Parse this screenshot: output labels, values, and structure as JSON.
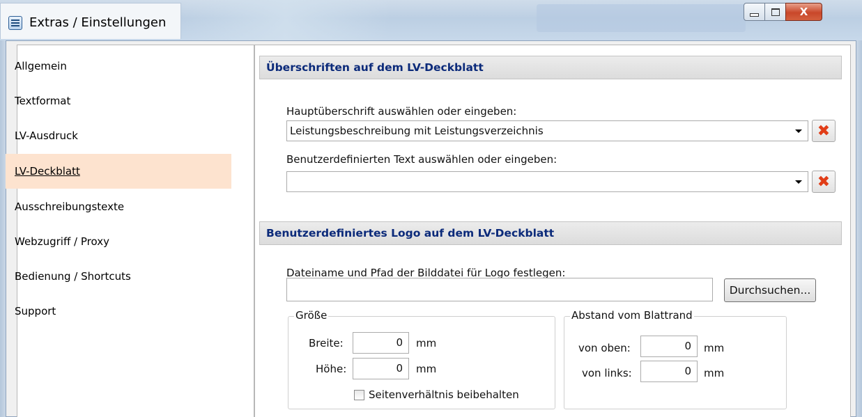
{
  "window": {
    "title": "Extras / Einstellungen",
    "close_glyph": "X"
  },
  "sidebar": {
    "items": [
      {
        "label": "Allgemein"
      },
      {
        "label": "Textformat"
      },
      {
        "label": "LV-Ausdruck"
      },
      {
        "label": "LV-Deckblatt",
        "active": true
      },
      {
        "label": "Ausschreibungstexte"
      },
      {
        "label": "Webzugriff / Proxy"
      },
      {
        "label": "Bedienung / Shortcuts"
      },
      {
        "label": "Support"
      }
    ]
  },
  "headings": {
    "section": "Überschriften auf dem LV-Deckblatt",
    "main_label": "Hauptüberschrift auswählen oder eingeben:",
    "main_value": "Leistungsbeschreibung mit Leistungsverzeichnis",
    "custom_label": "Benutzerdefinierten Text auswählen oder eingeben:",
    "custom_value": ""
  },
  "logo": {
    "section": "Benutzerdefiniertes Logo auf dem LV-Deckblatt",
    "path_label": "Dateiname und Pfad der Bilddatei für Logo festlegen:",
    "path_value": "",
    "browse_label": "Durchsuchen...",
    "size": {
      "title": "Größe",
      "width_label": "Breite:",
      "width_value": "0",
      "height_label": "Höhe:",
      "height_value": "0",
      "unit": "mm",
      "keep_ratio_label": "Seitenverhältnis beibehalten",
      "keep_ratio_checked": false
    },
    "margin": {
      "title": "Abstand vom Blattrand",
      "top_label": "von oben:",
      "top_value": "0",
      "left_label": "von links:",
      "left_value": "0",
      "unit": "mm"
    }
  },
  "colors": {
    "section_header_text": "#0b2a7a",
    "active_nav_bg": "#fde3cf",
    "delete_icon": "#e13d17"
  }
}
